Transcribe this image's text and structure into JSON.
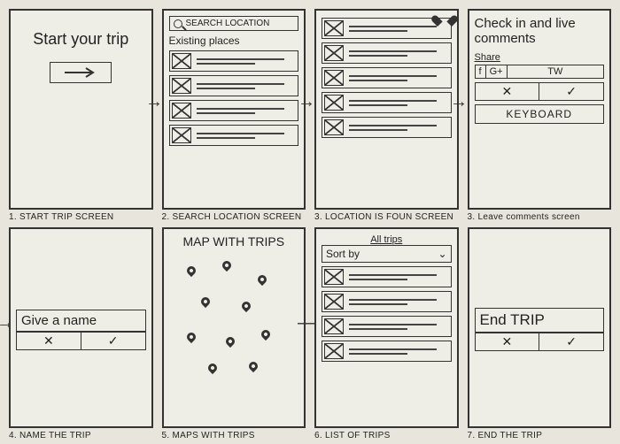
{
  "screens": {
    "start": {
      "title": "Start your trip",
      "caption": "1. START TRIP SCREEN"
    },
    "search": {
      "placeholder": "SEARCH LOCATION",
      "subhead": "Existing places",
      "caption": "2. SEARCH LOCATION SCREEN"
    },
    "found": {
      "caption": "3. LOCATION IS FOUN SCREEN"
    },
    "comments": {
      "heading": "Check in and live comments",
      "share_label": "Share",
      "share_fb": "f",
      "share_gp": "G+",
      "share_tw": "TW",
      "cancel": "✕",
      "ok": "✓",
      "keyboard": "KEYBOARD",
      "caption": "3. Leave comments screen"
    },
    "name": {
      "label": "Give a name",
      "cancel": "✕",
      "ok": "✓",
      "caption": "4. NAME THE TRIP"
    },
    "map": {
      "heading": "MAP WITH TRIPS",
      "caption": "5. MAPS WITH TRIPS"
    },
    "list": {
      "tab": "All trips",
      "sort": "Sort by",
      "caption": "6. LIST OF TRIPS"
    },
    "end": {
      "label": "End TRIP",
      "cancel": "✕",
      "ok": "✓",
      "caption": "7. END THE TRIP"
    }
  }
}
